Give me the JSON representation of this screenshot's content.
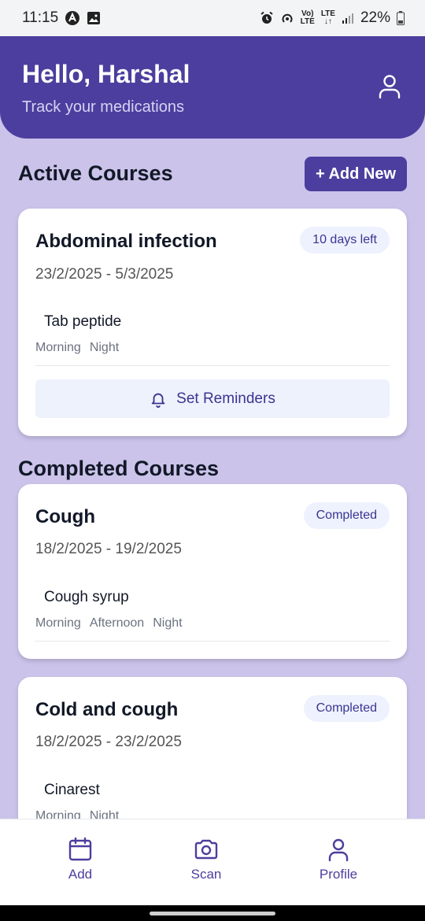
{
  "status_bar": {
    "time": "11:15",
    "battery": "22%",
    "volte_1": "Vo)",
    "volte_2": "LTE",
    "lte_1": "LTE",
    "lte_2": "↓↑"
  },
  "header": {
    "greeting": "Hello, Harshal",
    "subtitle": "Track your medications"
  },
  "active": {
    "title": "Active Courses",
    "add_label": "+ Add New",
    "courses": [
      {
        "name": "Abdominal infection",
        "badge": "10 days left",
        "dates": "23/2/2025 - 5/3/2025",
        "medicine": "Tab peptide",
        "times": [
          "Morning",
          "Night"
        ],
        "reminder_label": "Set Reminders"
      }
    ]
  },
  "completed": {
    "title": "Completed Courses",
    "courses": [
      {
        "name": "Cough",
        "badge": "Completed",
        "dates": "18/2/2025 - 19/2/2025",
        "medicine": "Cough syrup",
        "times": [
          "Morning",
          "Afternoon",
          "Night"
        ]
      },
      {
        "name": "Cold and cough",
        "badge": "Completed",
        "dates": "18/2/2025 - 23/2/2025",
        "medicine": "Cinarest",
        "times": [
          "Morning",
          "Night"
        ]
      }
    ]
  },
  "nav": [
    {
      "label": "Add",
      "icon": "calendar-icon"
    },
    {
      "label": "Scan",
      "icon": "camera-icon"
    },
    {
      "label": "Profile",
      "icon": "user-icon"
    }
  ],
  "colors": {
    "primary": "#4c3e9e",
    "background": "#cbc3ea",
    "badge_bg": "#eef2ff"
  }
}
